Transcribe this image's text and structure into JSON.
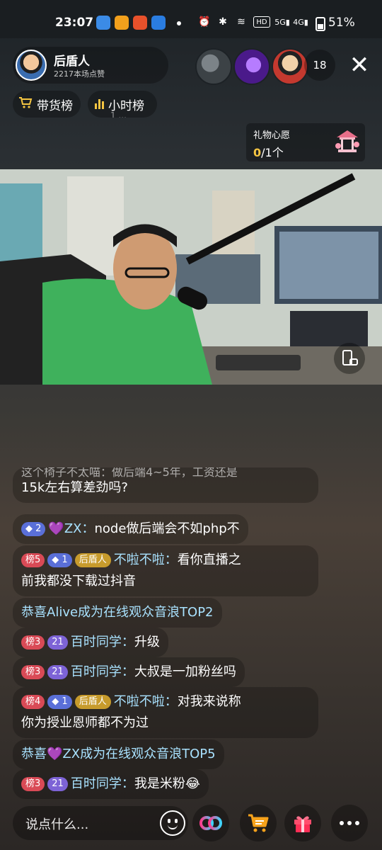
{
  "status_bar": {
    "time": "23:07",
    "battery_pct": "51%",
    "icons": [
      "alarm-icon",
      "bluetooth-icon",
      "wifi-icon",
      "hd-icon",
      "5g-signal-icon",
      "4g-signal-icon",
      "battery-icon"
    ]
  },
  "header": {
    "host_name": "后盾人",
    "host_likes": "2217本场点赞",
    "viewer_count": "18",
    "close_label": "✕"
  },
  "pills": {
    "cart_label": "带货榜",
    "rank_label": "小时榜",
    "rank_sub": "1 ..."
  },
  "wish": {
    "title": "礼物心愿",
    "current": "0",
    "total": "/1个"
  },
  "comments": [
    {
      "type": "text",
      "text": "这个椅子不太喵：做后端4~5年，工资还是",
      "continuation": "15k左右算差劲吗?"
    },
    {
      "type": "chat",
      "badges": [
        {
          "kind": "lvl",
          "text": "◆ 2"
        }
      ],
      "name": "💜ZX：",
      "text": "node做后端会不如php不"
    },
    {
      "type": "chat",
      "badges": [
        {
          "kind": "rank",
          "text": "榜5"
        },
        {
          "kind": "lvl",
          "text": "◆ 1"
        },
        {
          "kind": "club",
          "text": "后盾人"
        }
      ],
      "name": "不啦不啦：",
      "text": "看你直播之",
      "continuation": "前我都没下载过抖音"
    },
    {
      "type": "system",
      "text": "恭喜Alive成为在线观众音浪TOP2"
    },
    {
      "type": "chat",
      "badges": [
        {
          "kind": "rank",
          "text": "榜3"
        },
        {
          "kind": "fan",
          "text": "21"
        }
      ],
      "name": "百时同学：",
      "text": "升级"
    },
    {
      "type": "chat",
      "badges": [
        {
          "kind": "rank",
          "text": "榜3"
        },
        {
          "kind": "fan",
          "text": "21"
        }
      ],
      "name": "百时同学：",
      "text": "大叔是一加粉丝吗"
    },
    {
      "type": "chat",
      "badges": [
        {
          "kind": "rank",
          "text": "榜4"
        },
        {
          "kind": "lvl",
          "text": "◆ 1"
        },
        {
          "kind": "club",
          "text": "后盾人"
        }
      ],
      "name": "不啦不啦：",
      "text": "对我来说称",
      "continuation": "你为授业恩师都不为过"
    },
    {
      "type": "system",
      "text": "恭喜💜ZX成为在线观众音浪TOP5"
    },
    {
      "type": "chat",
      "badges": [
        {
          "kind": "rank",
          "text": "榜3"
        },
        {
          "kind": "fan",
          "text": "21"
        }
      ],
      "name": "百时同学：",
      "text": "我是米粉😂"
    }
  ],
  "bottom": {
    "input_placeholder": "说点什么..."
  }
}
